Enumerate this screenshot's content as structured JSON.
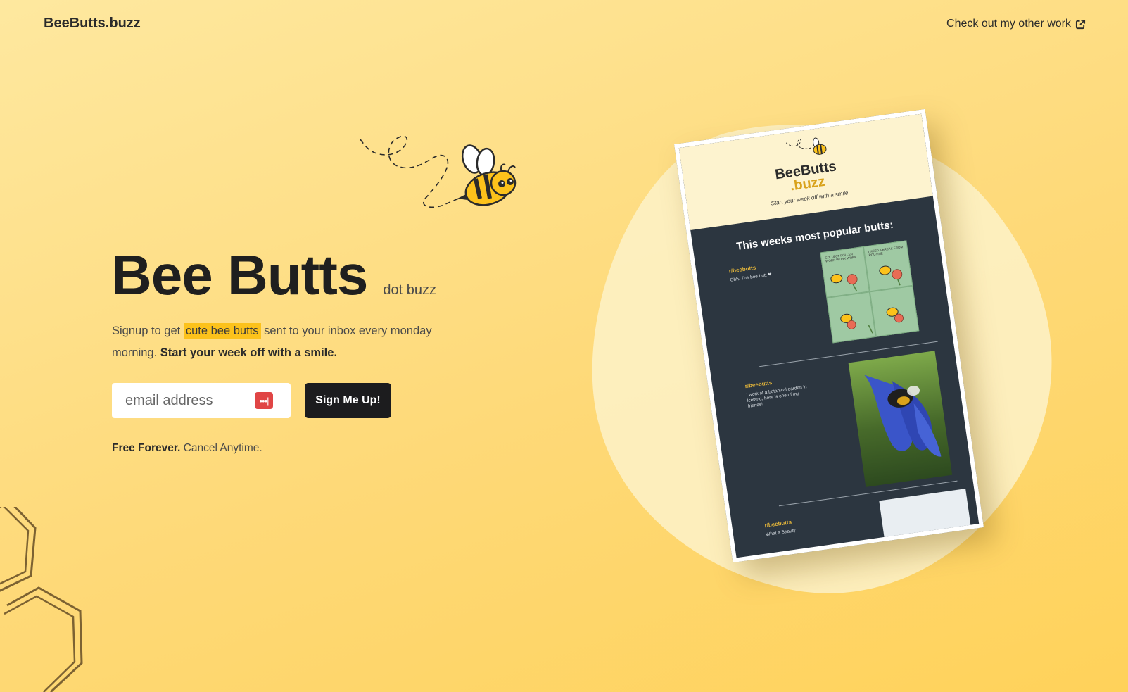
{
  "header": {
    "brand": "BeeButts.buzz",
    "other_work_label": "Check out my other work",
    "other_work_icon": "external-link-icon"
  },
  "hero": {
    "title": "Bee Butts",
    "subtitle": "dot buzz",
    "tagline_prefix": "Signup to get",
    "tagline_highlight": "cute bee butts",
    "tagline_middle": "sent to your inbox every monday morning.",
    "tagline_bold": "Start your week off with a smile.",
    "email_placeholder": "email address",
    "password_manager_icon": "password-manager-icon",
    "signup_label": "Sign Me Up!",
    "free_bold": "Free Forever.",
    "free_rest": "Cancel Anytime."
  },
  "preview": {
    "logo_line1": "BeeButts",
    "logo_line2": ".buzz",
    "tagline": "Start your week off with a smile",
    "heading": "This weeks most popular butts:",
    "posts": [
      {
        "author": "r/beebutts",
        "text": "Ohh. The bee butt ❤"
      },
      {
        "author": "r/beebutts",
        "text": "I work at a botanical garden in Iceland, here is one of my friends!"
      },
      {
        "author": "r/beebutts",
        "text": "What a Beauty"
      }
    ],
    "comic_text_1": "COLLECT POLLEN WORK WORK WORK",
    "comic_text_2": "I NEED A BREAK FROM ROUTINE"
  },
  "colors": {
    "background_top": "#fee89f",
    "background_bottom": "#ffd25a",
    "highlight": "#fcc21b",
    "button": "#1c1c1e",
    "preview_dark": "#2c3640",
    "preview_header": "#fdf3cf"
  }
}
